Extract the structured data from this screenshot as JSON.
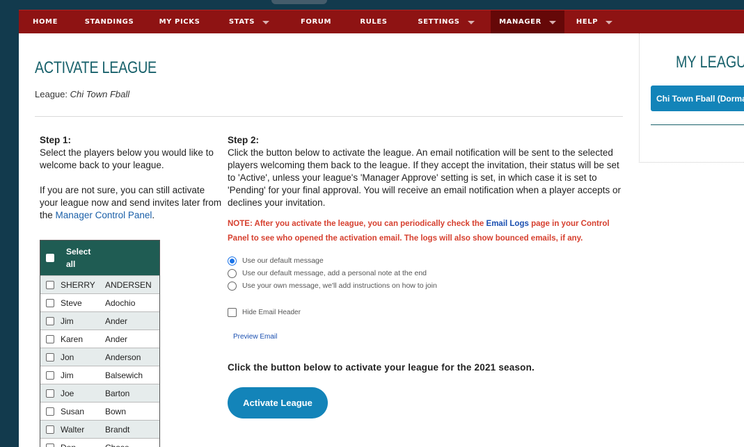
{
  "nav": {
    "items": [
      {
        "label": "HOME",
        "has_dropdown": false
      },
      {
        "label": "STANDINGS",
        "has_dropdown": false
      },
      {
        "label": "MY PICKS",
        "has_dropdown": false
      },
      {
        "label": "STATS",
        "has_dropdown": true
      },
      {
        "label": "FORUM",
        "has_dropdown": false
      },
      {
        "label": "RULES",
        "has_dropdown": false
      },
      {
        "label": "SETTINGS",
        "has_dropdown": true
      },
      {
        "label": "MANAGER",
        "has_dropdown": true,
        "active": true
      },
      {
        "label": "HELP",
        "has_dropdown": true
      }
    ]
  },
  "main": {
    "title": "ACTIVATE LEAGUE",
    "league_label": "League:",
    "league_name": "Chi Town Fball",
    "step1": {
      "heading": "Step 1:",
      "text1": "Select the players below you would like to welcome back to your league.",
      "text2_before": "If you are not sure, you can still activate your league now and send invites later from the",
      "link": "Manager Control Panel",
      "text2_after": "."
    },
    "step2": {
      "heading": "Step 2:",
      "text": "Click the button below to activate the league.  An email notification will be sent to the selected players welcoming them back to the league. If they accept the invitation, their status will be set to 'Active', unless your league's 'Manager Approve' setting is set, in which case it is set to 'Pending' for your final approval. You will receive an email notification when a player accepts or declines your invitation."
    },
    "note": {
      "before": "NOTE: After you activate the league, you can periodically check the",
      "link": "Email Logs",
      "after": "page in your Control Panel to see who opened the activation email. The logs will also show bounced emails, if any."
    },
    "message_options": [
      {
        "label": "Use our default message",
        "checked": true
      },
      {
        "label": "Use our default message, add a personal note at the end",
        "checked": false
      },
      {
        "label": "Use your own message, we'll add instructions on how to join",
        "checked": false
      }
    ],
    "hide_header_label": "Hide Email Header",
    "preview_label": "Preview Email",
    "cta_text": "Click the button below to activate your league for the 2021 season.",
    "activate_button": "Activate League"
  },
  "players": {
    "select_all": "Select all",
    "rows": [
      {
        "first": "SHERRY",
        "last": "ANDERSEN"
      },
      {
        "first": "Steve",
        "last": "Adochio"
      },
      {
        "first": "Jim",
        "last": "Ander"
      },
      {
        "first": "Karen",
        "last": "Ander"
      },
      {
        "first": "Jon",
        "last": "Anderson"
      },
      {
        "first": "Jim",
        "last": "Balsewich"
      },
      {
        "first": "Joe",
        "last": "Barton"
      },
      {
        "first": "Susan",
        "last": "Bown"
      },
      {
        "first": "Walter",
        "last": "Brandt"
      },
      {
        "first": "Don",
        "last": "Chase"
      }
    ]
  },
  "sidebar": {
    "title": "MY LEAGUES",
    "league": "Chi Town Fball (Dorma"
  }
}
